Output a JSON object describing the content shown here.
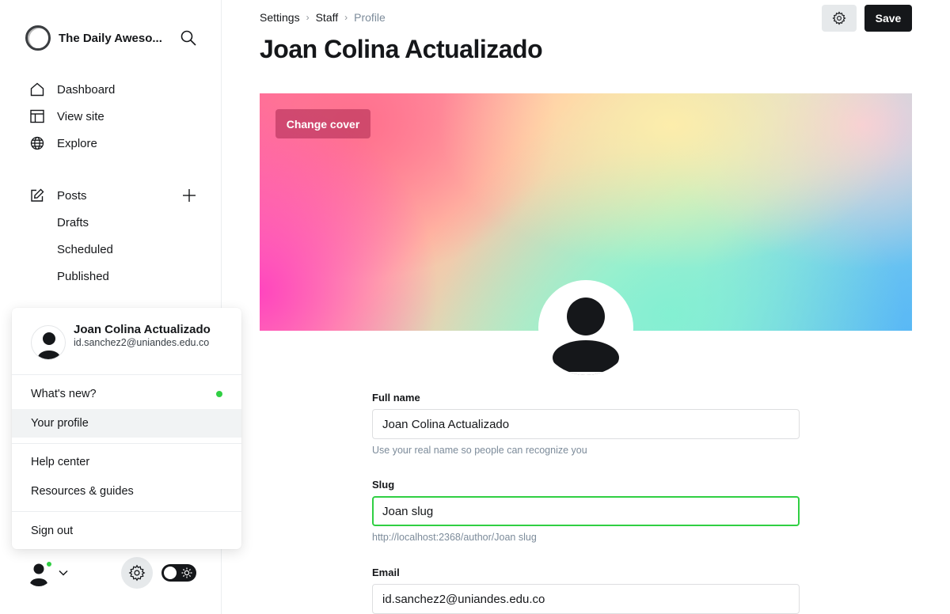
{
  "sidebar": {
    "site_title": "The Daily Aweso...",
    "nav": {
      "dashboard": "Dashboard",
      "view_site": "View site",
      "explore": "Explore",
      "posts": "Posts",
      "drafts": "Drafts",
      "scheduled": "Scheduled",
      "published": "Published"
    }
  },
  "user_menu": {
    "name": "Joan Colina Actualizado",
    "email": "id.sanchez2@uniandes.edu.co",
    "items": {
      "whats_new": "What's new?",
      "your_profile": "Your profile",
      "help_center": "Help center",
      "resources": "Resources & guides",
      "sign_out": "Sign out"
    }
  },
  "breadcrumb": {
    "settings": "Settings",
    "staff": "Staff",
    "profile": "Profile"
  },
  "header": {
    "title": "Joan Colina Actualizado",
    "save_label": "Save"
  },
  "cover": {
    "change_cover_label": "Change cover"
  },
  "form": {
    "full_name": {
      "label": "Full name",
      "value": "Joan Colina Actualizado",
      "hint": "Use your real name so people can recognize you"
    },
    "slug": {
      "label": "Slug",
      "value": "Joan slug",
      "hint": "http://localhost:2368/author/Joan slug"
    },
    "email": {
      "label": "Email",
      "value": "id.sanchez2@uniandes.edu.co"
    }
  },
  "colors": {
    "accent_green": "#30cf43",
    "primary_dark": "#15171a"
  }
}
